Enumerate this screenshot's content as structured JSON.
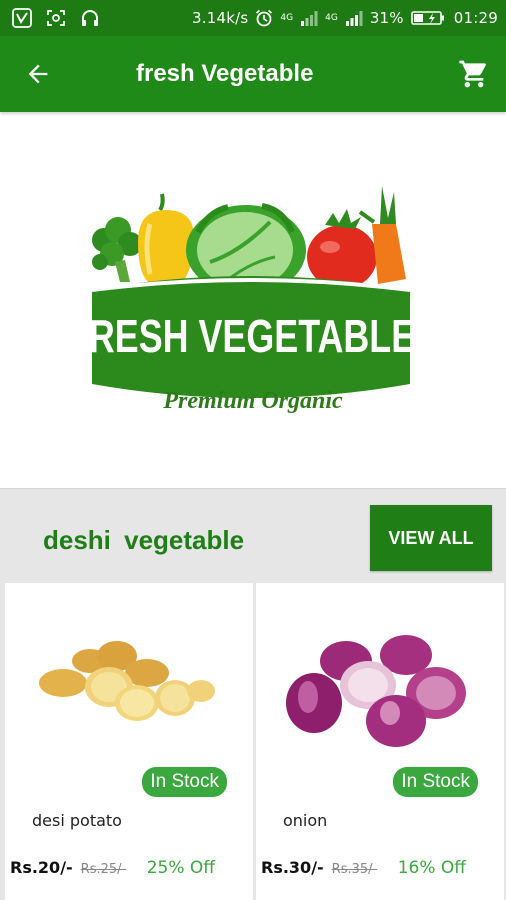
{
  "status_bar": {
    "speed": "3.14k/s",
    "network_1": "4G",
    "network_2": "4G",
    "battery": "31%",
    "time": "01:29"
  },
  "toolbar": {
    "title": "fresh Vegetable",
    "back_icon": "arrow-back-icon",
    "cart_icon": "shopping-cart-icon"
  },
  "banner": {
    "title": "FRESH VEGETABLES",
    "subtitle": "Premium Organic"
  },
  "section": {
    "title": "deshi  vegetable",
    "view_all_label": "VIEW ALL"
  },
  "products": [
    {
      "name": "desi potato",
      "stock": "In Stock",
      "price": "Rs.20/-",
      "mrp": "Rs.25/-",
      "discount": "25% Off"
    },
    {
      "name": "onion",
      "stock": "In Stock",
      "price": "Rs.30/-",
      "mrp": "Rs.35/-",
      "discount": "16% Off"
    }
  ],
  "colors": {
    "status_bar": "#1e7a12",
    "toolbar": "#1f8a17",
    "accent": "#1f7e16",
    "stock_badge": "#3aa73f"
  }
}
